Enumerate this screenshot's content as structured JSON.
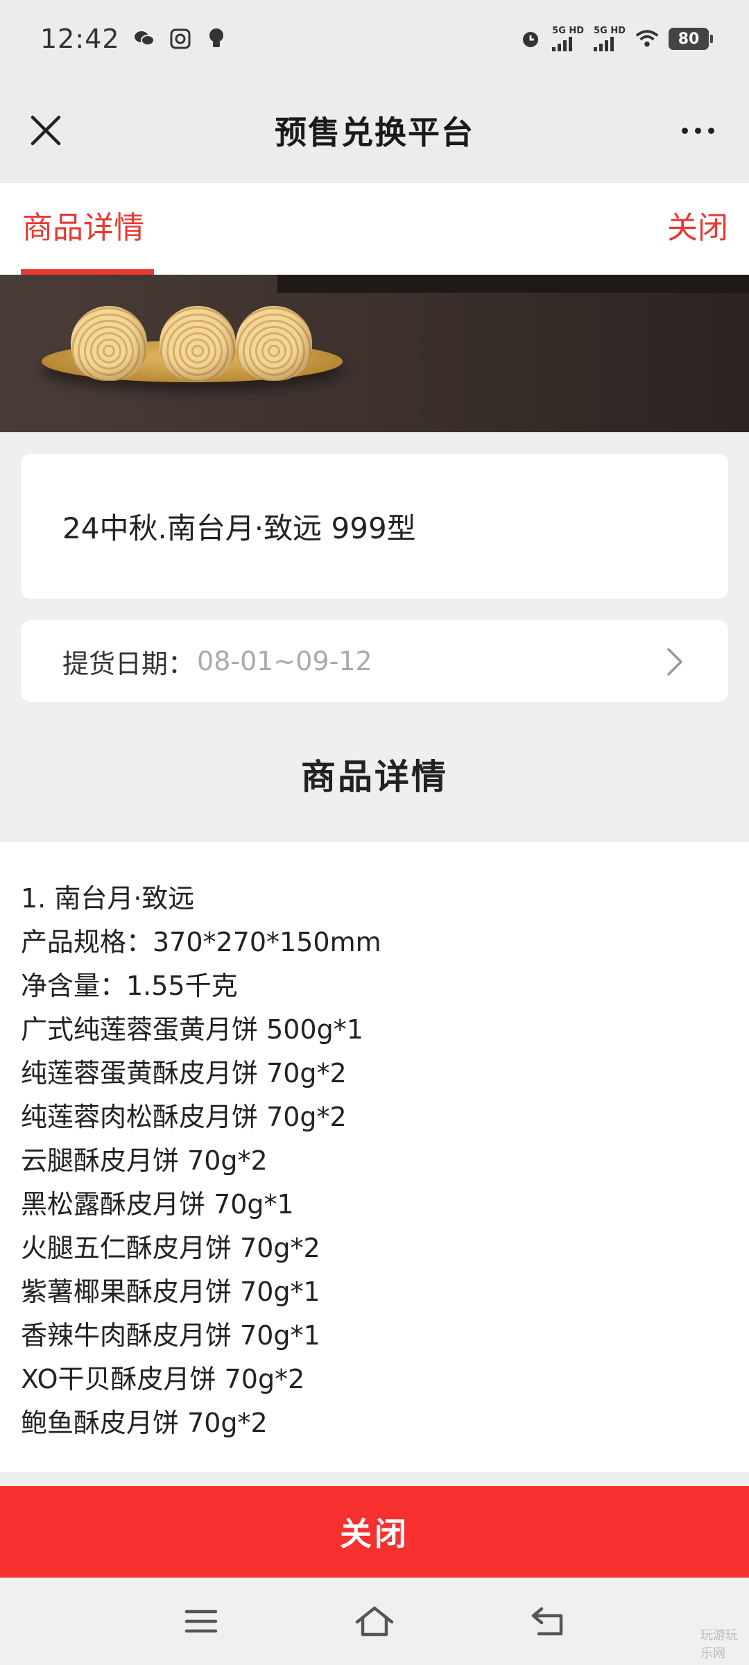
{
  "status_bar": {
    "time": "12:42",
    "signal_1": "5G HD",
    "signal_2": "5G HD",
    "battery": "80"
  },
  "nav": {
    "title": "预售兑换平台"
  },
  "tabs": {
    "active_label": "商品详情",
    "close_label": "关闭"
  },
  "product": {
    "name": "24中秋.南台月·致远 999型",
    "pickup_label": "提货日期：",
    "pickup_value": "08-01~09-12"
  },
  "details": {
    "heading": "商品详情",
    "lines": [
      "1. 南台月·致远",
      "产品规格：370*270*150mm",
      "净含量：1.55千克",
      "广式纯莲蓉蛋黄月饼 500g*1",
      "纯莲蓉蛋黄酥皮月饼 70g*2",
      "纯莲蓉肉松酥皮月饼 70g*2",
      "云腿酥皮月饼 70g*2",
      "黑松露酥皮月饼 70g*1",
      "火腿五仁酥皮月饼 70g*2",
      "紫薯椰果酥皮月饼 70g*1",
      "香辣牛肉酥皮月饼 70g*1",
      "XO干贝酥皮月饼 70g*2",
      "鲍鱼酥皮月饼 70g*2"
    ]
  },
  "bottom_button": {
    "label": "关闭"
  },
  "colors": {
    "accent": "#e63a32",
    "button": "#f5302f"
  },
  "watermark": "玩游玩乐网"
}
